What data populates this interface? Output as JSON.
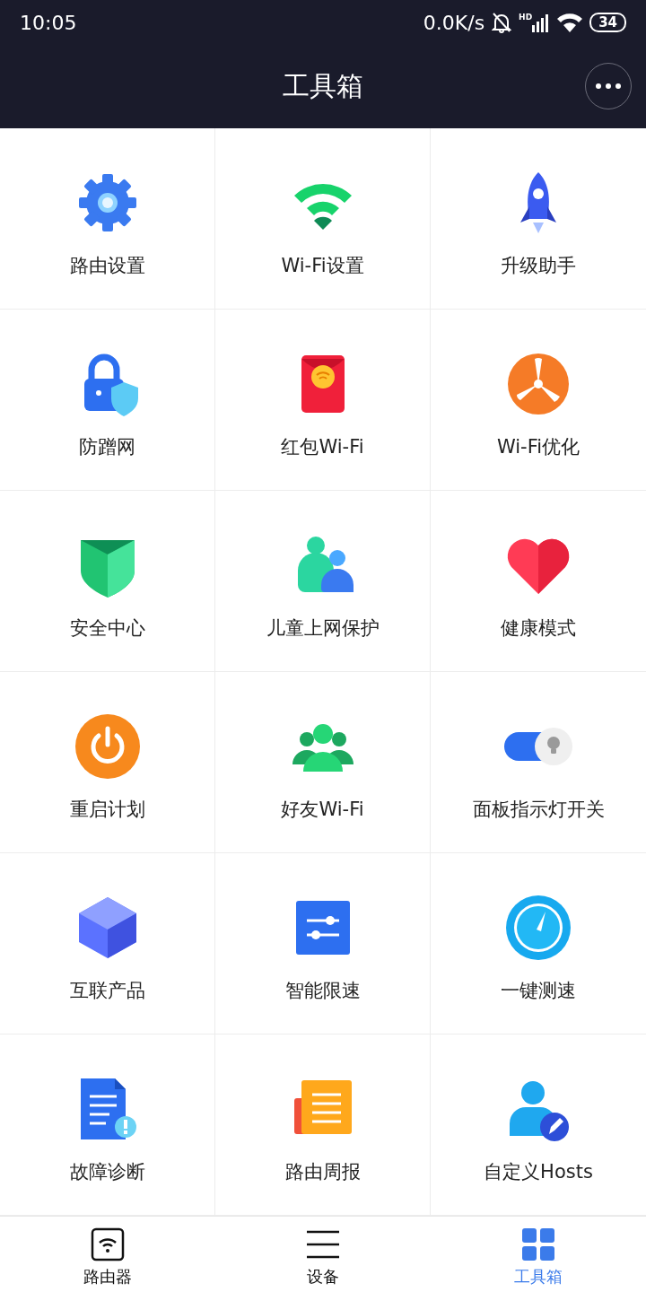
{
  "status_bar": {
    "time": "10:05",
    "speed": "0.0K/s",
    "signal_label": "HD",
    "battery": "34"
  },
  "header": {
    "title": "工具箱"
  },
  "tools": [
    {
      "label": "路由设置"
    },
    {
      "label": "Wi-Fi设置"
    },
    {
      "label": "升级助手"
    },
    {
      "label": "防蹭网"
    },
    {
      "label": "红包Wi-Fi"
    },
    {
      "label": "Wi-Fi优化"
    },
    {
      "label": "安全中心"
    },
    {
      "label": "儿童上网保护"
    },
    {
      "label": "健康模式"
    },
    {
      "label": "重启计划"
    },
    {
      "label": "好友Wi-Fi"
    },
    {
      "label": "面板指示灯开关"
    },
    {
      "label": "互联产品"
    },
    {
      "label": "智能限速"
    },
    {
      "label": "一键测速"
    },
    {
      "label": "故障诊断"
    },
    {
      "label": "路由周报"
    },
    {
      "label": "自定义Hosts"
    }
  ],
  "bottom_nav": [
    {
      "label": "路由器",
      "selected": false
    },
    {
      "label": "设备",
      "selected": false
    },
    {
      "label": "工具箱",
      "selected": true
    }
  ]
}
